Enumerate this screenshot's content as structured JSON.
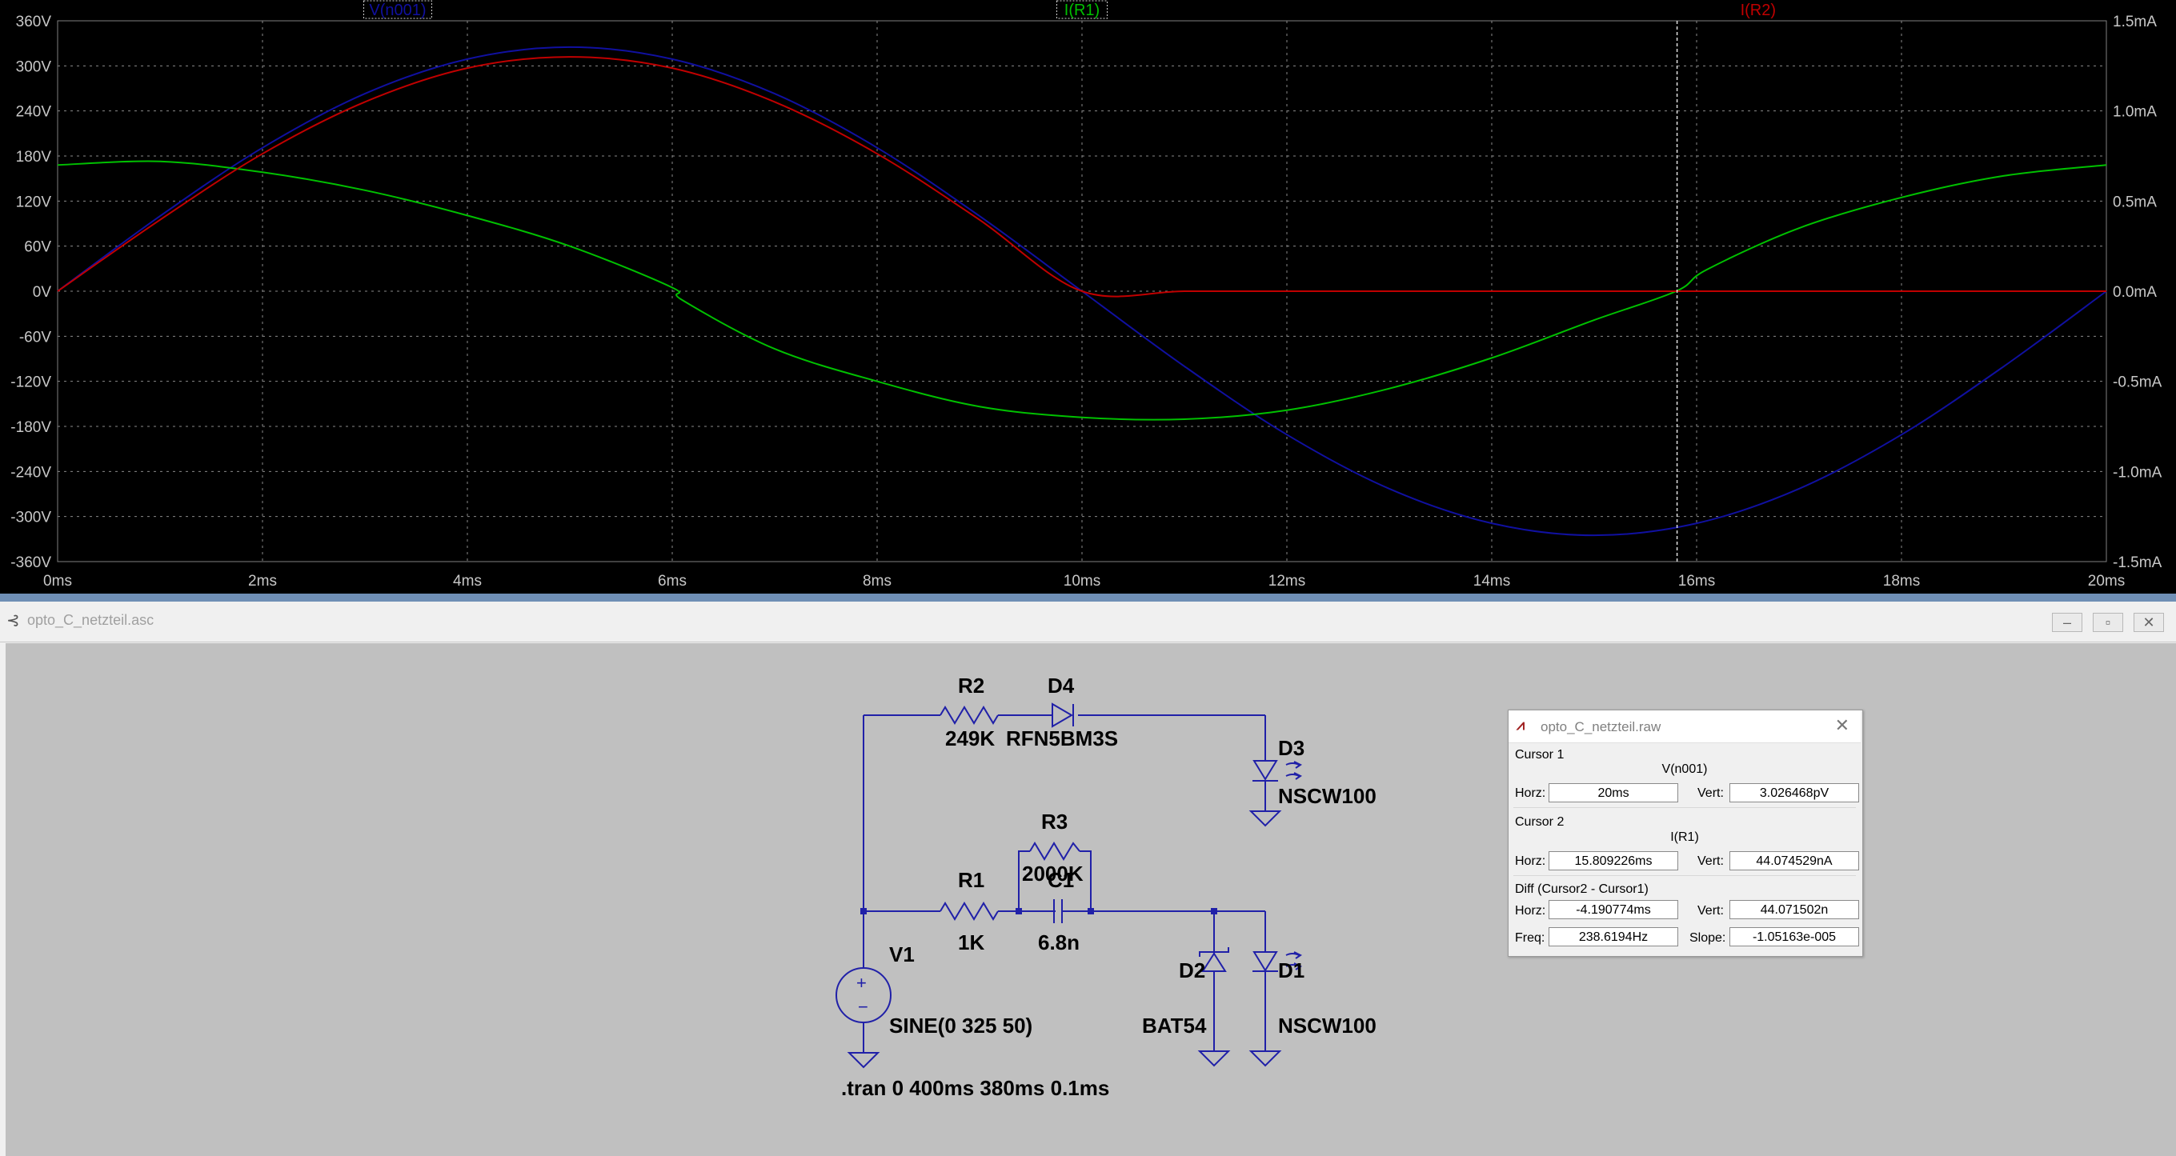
{
  "plot": {
    "x_ticks": [
      "0ms",
      "2ms",
      "4ms",
      "6ms",
      "8ms",
      "10ms",
      "12ms",
      "14ms",
      "16ms",
      "18ms",
      "20ms"
    ],
    "y_left_ticks": [
      "360V",
      "300V",
      "240V",
      "180V",
      "120V",
      "60V",
      "0V",
      "-60V",
      "-120V",
      "-180V",
      "-240V",
      "-300V",
      "-360V"
    ],
    "y_right_ticks": [
      "1.5mA",
      "1.0mA",
      "0.5mA",
      "0.0mA",
      "-0.5mA",
      "-1.0mA",
      "-1.5mA"
    ],
    "traces": [
      {
        "name": "V(n001)",
        "color": "#1010a0"
      },
      {
        "name": "I(R1)",
        "color": "#00c000"
      },
      {
        "name": "I(R2)",
        "color": "#c00000"
      }
    ],
    "cursor_x_ms": 15.809226
  },
  "chart_data": {
    "type": "line",
    "xlabel": "",
    "ylabel": "",
    "xlim": [
      0,
      20
    ],
    "ylim": [
      -360,
      360
    ],
    "ylim_right": [
      -1.5,
      1.5
    ],
    "grid": true,
    "series": [
      {
        "name": "V(n001)",
        "axis": "left",
        "unit": "V",
        "color": "#1010a0",
        "x": [
          0,
          1,
          2,
          3,
          4,
          5,
          6,
          7,
          8,
          9,
          10,
          11,
          12,
          13,
          14,
          15,
          16,
          17,
          18,
          19,
          20
        ],
        "y": [
          0,
          100,
          191,
          263,
          309,
          325,
          309,
          263,
          191,
          100,
          0,
          -100,
          -191,
          -263,
          -309,
          -325,
          -309,
          -263,
          -191,
          -100,
          0
        ]
      },
      {
        "name": "I(R1)",
        "axis": "right",
        "unit": "mA",
        "color": "#00c000",
        "x": [
          0,
          1,
          2,
          3,
          4,
          5,
          6,
          6.1,
          7,
          8,
          9,
          10,
          11,
          12,
          13,
          14,
          15,
          15.8,
          16.1,
          17,
          18,
          19,
          20
        ],
        "y": [
          0.7,
          0.72,
          0.66,
          0.56,
          0.42,
          0.25,
          0.02,
          -0.05,
          -0.32,
          -0.5,
          -0.64,
          -0.7,
          -0.71,
          -0.66,
          -0.54,
          -0.37,
          -0.16,
          0,
          0.12,
          0.35,
          0.52,
          0.64,
          0.7
        ]
      },
      {
        "name": "I(R2)",
        "axis": "left_scaled",
        "unit": "",
        "color": "#c00000",
        "x": [
          0,
          1,
          2,
          3,
          4,
          5,
          6,
          7,
          8,
          9,
          10,
          11,
          12,
          13,
          14,
          15,
          16,
          17,
          18,
          19,
          20
        ],
        "y": [
          0,
          95,
          183,
          252,
          297,
          312,
          297,
          252,
          183,
          95,
          0,
          0,
          0,
          0,
          0,
          0,
          0,
          0,
          0,
          0,
          0
        ]
      }
    ]
  },
  "schematic": {
    "window_title": "opto_C_netzteil.asc",
    "components": {
      "r2_name": "R2",
      "r2_value": "249K",
      "d4_name": "D4",
      "d4_value": "RFN5BM3S",
      "r3_name": "R3",
      "r3_value": "2000K",
      "r1_name": "R1",
      "r1_value": "1K",
      "c1_name": "C1",
      "c1_value": "6.8n",
      "d3_name": "D3",
      "d3_value": "NSCW100",
      "v1_name": "V1",
      "v1_value": "SINE(0 325 50)",
      "d2_name": "D2",
      "d2_value": "BAT54",
      "d1_name": "D1",
      "d1_value": "NSCW100"
    },
    "directive": ".tran 0 400ms 380ms 0.1ms"
  },
  "cursor_dialog": {
    "title": "opto_C_netzteil.raw",
    "cursor1": {
      "label": "Cursor 1",
      "trace": "V(n001)",
      "horz_label": "Horz:",
      "horz": "20ms",
      "vert_label": "Vert:",
      "vert": "3.026468pV"
    },
    "cursor2": {
      "label": "Cursor 2",
      "trace": "I(R1)",
      "horz_label": "Horz:",
      "horz": "15.809226ms",
      "vert_label": "Vert:",
      "vert": "44.074529nA"
    },
    "diff": {
      "label": "Diff (Cursor2 - Cursor1)",
      "horz_label": "Horz:",
      "horz": "-4.190774ms",
      "vert_label": "Vert:",
      "vert": "44.071502n",
      "freq_label": "Freq:",
      "freq": "238.6194Hz",
      "slope_label": "Slope:",
      "slope": "-1.05163e-005"
    }
  }
}
